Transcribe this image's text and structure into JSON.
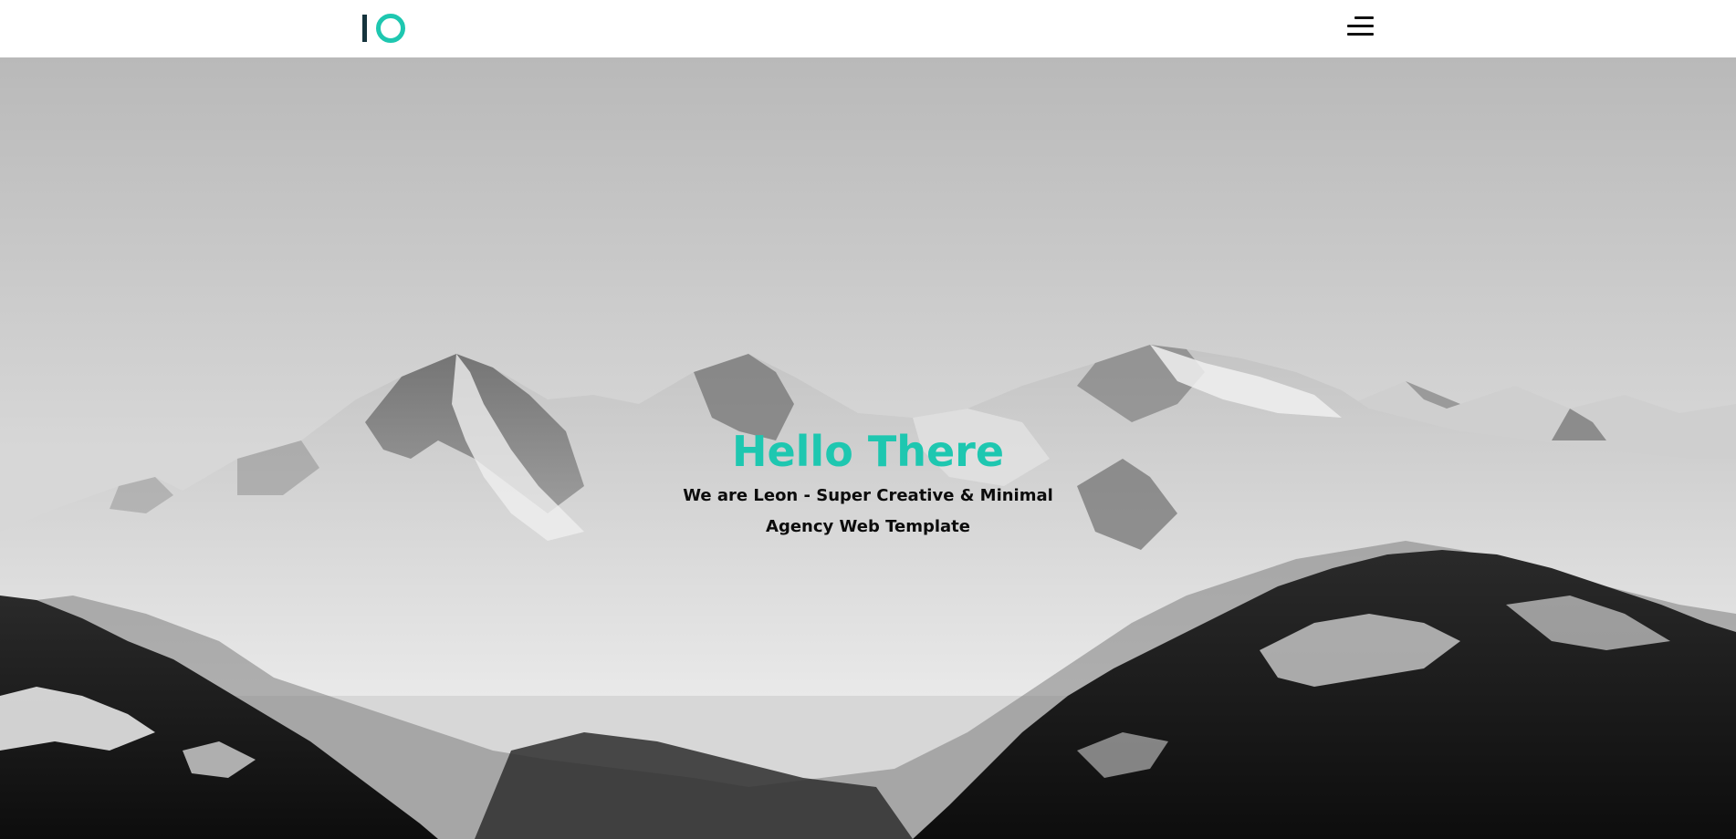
{
  "header": {
    "logo_icon": "io-logo-icon",
    "menu_icon": "hamburger-menu-icon"
  },
  "hero": {
    "title": "Hello There",
    "subtitle": "We are Leon - Super Creative & Minimal Agency Web Template",
    "background_icon": "snowy-mountains-image"
  },
  "colors": {
    "accent": "#1ec7b0",
    "logo_dark": "#16343d",
    "header_bg": "#ffffff",
    "text_dark": "#0c0c0c"
  }
}
